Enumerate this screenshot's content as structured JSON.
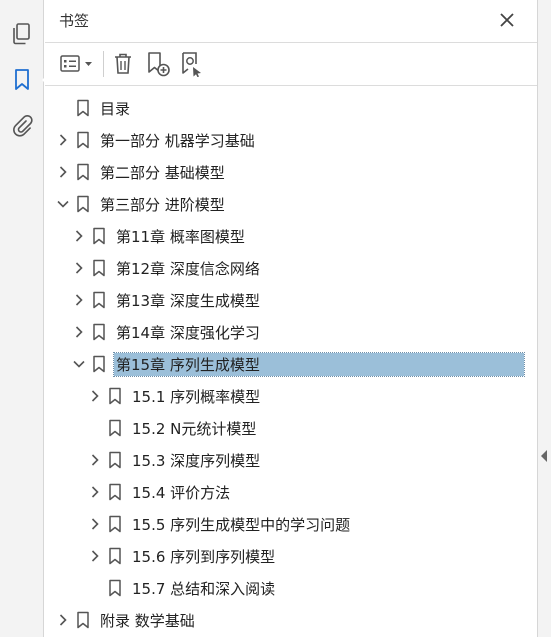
{
  "panel": {
    "title": "书签"
  },
  "toolbar": {
    "options_icon": "list-options-icon",
    "delete_icon": "trash-icon",
    "new_bookmark_icon": "new-bookmark-icon",
    "find_bookmark_icon": "find-bookmark-icon"
  },
  "rail": {
    "items": [
      {
        "name": "page-thumbnails-icon",
        "active": false
      },
      {
        "name": "bookmarks-icon",
        "active": true
      },
      {
        "name": "attachments-icon",
        "active": false
      }
    ]
  },
  "tree": {
    "items": [
      {
        "label": "目录",
        "level": 0,
        "chevron": "none",
        "selected": false
      },
      {
        "label": "第一部分 机器学习基础",
        "level": 0,
        "chevron": "right",
        "selected": false
      },
      {
        "label": "第二部分 基础模型",
        "level": 0,
        "chevron": "right",
        "selected": false
      },
      {
        "label": "第三部分 进阶模型",
        "level": 0,
        "chevron": "down",
        "selected": false
      },
      {
        "label": "第11章  概率图模型",
        "level": 1,
        "chevron": "right",
        "selected": false
      },
      {
        "label": "第12章  深度信念网络",
        "level": 1,
        "chevron": "right",
        "selected": false
      },
      {
        "label": "第13章  深度生成模型",
        "level": 1,
        "chevron": "right",
        "selected": false
      },
      {
        "label": "第14章  深度强化学习",
        "level": 1,
        "chevron": "right",
        "selected": false
      },
      {
        "label": "第15章  序列生成模型",
        "level": 1,
        "chevron": "down",
        "selected": true
      },
      {
        "label": "15.1 序列概率模型",
        "level": 2,
        "chevron": "right",
        "selected": false
      },
      {
        "label": "15.2 N元统计模型",
        "level": 2,
        "chevron": "none",
        "selected": false
      },
      {
        "label": "15.3 深度序列模型",
        "level": 2,
        "chevron": "right",
        "selected": false
      },
      {
        "label": "15.4 评价方法",
        "level": 2,
        "chevron": "right",
        "selected": false
      },
      {
        "label": "15.5 序列生成模型中的学习问题",
        "level": 2,
        "chevron": "right",
        "selected": false
      },
      {
        "label": "15.6 序列到序列模型",
        "level": 2,
        "chevron": "right",
        "selected": false
      },
      {
        "label": "15.7 总结和深入阅读",
        "level": 2,
        "chevron": "none",
        "selected": false
      },
      {
        "label": "附录  数学基础",
        "level": 0,
        "chevron": "right",
        "selected": false
      }
    ]
  },
  "colors": {
    "selection": "#9bbfd9",
    "icon": "#555555",
    "rail_bg": "#f3f3f3"
  }
}
